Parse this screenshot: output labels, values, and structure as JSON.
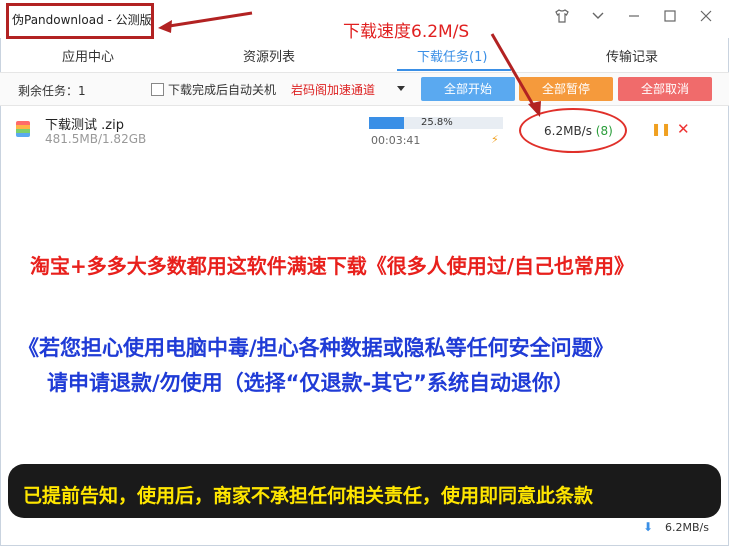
{
  "window": {
    "title": "伪Pandownload - 公测版"
  },
  "tabs": [
    {
      "label": "应用中心"
    },
    {
      "label": "资源列表"
    },
    {
      "label": "下载任务(1)"
    },
    {
      "label": "传输记录"
    }
  ],
  "toolbar": {
    "remaining": "剩余任务：1",
    "auto_shutdown": "下载完成后自动关机",
    "channel": "岩码阁加速通道",
    "start_all": "全部开始",
    "pause_all": "全部暂停",
    "cancel_all": "全部取消"
  },
  "task": {
    "name": "下载测试 .zip",
    "size": "481.5MB/1.82GB",
    "progress_text": "25.8%",
    "progress_value": 25.8,
    "elapsed": "00:03:41",
    "speed": "6.2MB/s",
    "connections": "(8)"
  },
  "annotations": {
    "speed_note": "下载速度6.2M/S",
    "line1": "淘宝+多多大多数都用这软件满速下载《很多人使用过/自己也常用》",
    "line2": "《若您担心使用电脑中毒/担心各种数据或隐私等任何安全问题》",
    "line3": "请申请退款/勿使用（选择“仅退款-其它”系统自动退你）",
    "banner": "已提前告知，使用后，商家不承担任何相关责任，使用即同意此条款"
  },
  "status": {
    "speed": "6.2MB/s"
  },
  "colors": {
    "accent": "#3a8fe6",
    "start": "#5aa9f0",
    "pause": "#f59a3c",
    "cancel": "#f06b6b"
  },
  "icons": [
    "shirt-icon",
    "chevron-down-icon",
    "minimize-icon",
    "maximize-icon",
    "close-icon",
    "zip-file-icon",
    "bolt-icon",
    "pause-icon",
    "cancel-icon",
    "download-arrow-icon"
  ]
}
